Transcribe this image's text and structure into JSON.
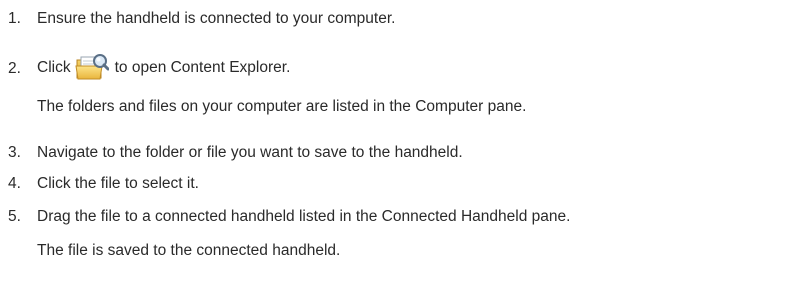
{
  "steps": [
    {
      "number": "1.",
      "text": "Ensure the handheld is connected to your computer."
    },
    {
      "number": "2.",
      "text_before": "Click",
      "icon": "content-explorer-folder-icon",
      "text_after": "to open Content Explorer.",
      "note": "The folders and files on your computer are listed in the Computer pane."
    },
    {
      "number": "3.",
      "text": "Navigate to the folder or file you want to save to the handheld."
    },
    {
      "number": "4.",
      "text": "Click the file to select it."
    },
    {
      "number": "5.",
      "text": "Drag the file to a connected handheld listed in the Connected Handheld pane.",
      "note": "The file is saved to the connected handheld."
    }
  ]
}
